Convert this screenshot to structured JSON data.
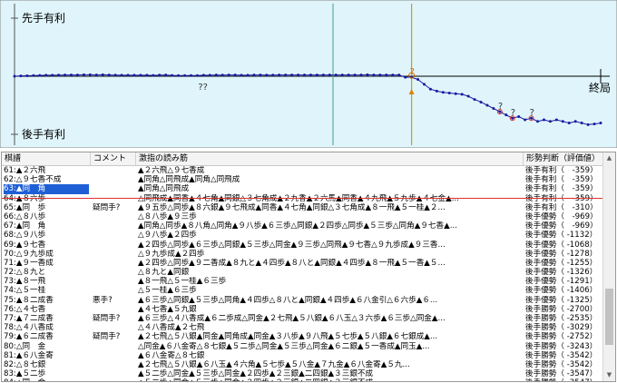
{
  "graph": {
    "label_top": "先手有利",
    "label_bottom": "後手有利",
    "label_end": "終局",
    "annotation_q": "??",
    "colors": {
      "bg": "#dff5fb",
      "line": "#1a1aa0",
      "cursor": "#d0a000",
      "vline": "#40a080"
    }
  },
  "chart_data": {
    "type": "line",
    "title": "",
    "xlabel": "",
    "ylabel": "",
    "x_range": [
      0,
      93
    ],
    "ylim": [
      -3000,
      3000
    ],
    "cursor_move": 63,
    "markers": [
      {
        "move": 30,
        "label": "??"
      },
      {
        "move": 63,
        "label": "?"
      },
      {
        "move": 77,
        "label": "?"
      },
      {
        "move": 79,
        "label": "?"
      },
      {
        "move": 82,
        "label": "?"
      }
    ],
    "series": [
      {
        "values": [
          0,
          10,
          15,
          20,
          25,
          30,
          30,
          35,
          40,
          40,
          40,
          45,
          45,
          40,
          45,
          40,
          35,
          30,
          30,
          30,
          30,
          30,
          25,
          35,
          40,
          25,
          20,
          20,
          20,
          20,
          30,
          30,
          40,
          35,
          40,
          40,
          30,
          30,
          40,
          40,
          35,
          35,
          40,
          40,
          40,
          40,
          40,
          40,
          40,
          40,
          40,
          40,
          40,
          40,
          40,
          40,
          45,
          40,
          40,
          40,
          40,
          40,
          -30,
          -30,
          -100,
          -250,
          -400,
          -460,
          -500,
          -520,
          -540,
          -560,
          -620,
          -720,
          -800,
          -900,
          -1000,
          -1100,
          -1200,
          -1300,
          -1250,
          -1350,
          -1300,
          -1400,
          -1350,
          -1400,
          -1350,
          -1400,
          -1450,
          -1400,
          -1450,
          -1500,
          -1480,
          -1450
        ]
      }
    ]
  },
  "table": {
    "headers": {
      "move": "棋譜",
      "comment": "コメント",
      "reading": "激指の読み筋",
      "eval": "形勢判断（評価値）"
    },
    "selected_index": 2,
    "rows": [
      {
        "move": "61:▲２六飛",
        "comment": "",
        "reading": "▲２六飛△９七香成",
        "eval": "後手有利（　-359）"
      },
      {
        "move": "62:△９七香不成",
        "comment": "",
        "reading": "▲同角△同飛成▲同角△同飛成",
        "eval": "後手有利（　-359）"
      },
      {
        "move": "63:▲同　角",
        "comment": "",
        "reading": "▲同角△同飛成",
        "eval": "後手有利（　-359）"
      },
      {
        "move": "64:▲８六歩",
        "comment": "",
        "reading": "△同飛成▲同香▲４七角▲同銀△３七角成▲２九香▲２六馬▲同香▲４九飛▲５九歩▲４七金▲...",
        "eval": "後手有利（　-359）"
      },
      {
        "move": "65:▲同　歩",
        "comment": "疑問手?",
        "reading": "▲９五歩△同歩▲８六銀▲９七飛成▲同香▲４七角▲同銀△３七角成▲８一飛▲５一桂▲２...",
        "eval": "後手有利（　-310）"
      },
      {
        "move": "66:△８八歩",
        "comment": "",
        "reading": "△８八歩▲９三歩",
        "eval": "後手優勢（　-969）"
      },
      {
        "move": "67:▲同　角",
        "comment": "",
        "reading": "▲同角△同歩▲８八角△同角▲９八歩▲６三歩△同銀▲２四歩△同歩▲５三歩△同角▲９七香▲...",
        "eval": "後手優勢（　-969）"
      },
      {
        "move": "68:△９八歩",
        "comment": "",
        "reading": "△９八歩▲２四歩",
        "eval": "後手優勢（ -1132）"
      },
      {
        "move": "69:▲９七香",
        "comment": "",
        "reading": "▲２四歩△同歩▲６三歩△同銀▲５三歩△同金▲９三歩△同飛▲９七香△９九歩成▲９三香...",
        "eval": "後手優勢（ -1068）"
      },
      {
        "move": "70:△９九歩成",
        "comment": "",
        "reading": "△９九歩成▲２四歩",
        "eval": "後手優勢（ -1278）"
      },
      {
        "move": "71:▲９一香成",
        "comment": "",
        "reading": "▲２四歩△同歩▲９二香成▲８九と▲４四歩▲８八と▲同銀▲４四歩▲８一飛▲５一香▲５...",
        "eval": "後手優勢（ -1255）"
      },
      {
        "move": "72:△８九と",
        "comment": "",
        "reading": "△８九と▲同銀",
        "eval": "後手優勢（ -1326）"
      },
      {
        "move": "73:▲８一飛",
        "comment": "",
        "reading": "▲８一飛△５一桂▲６三歩",
        "eval": "後手優勢（ -1291）"
      },
      {
        "move": "74:△５一桂",
        "comment": "",
        "reading": "△５一桂▲６三歩",
        "eval": "後手優勢（ -1406）"
      },
      {
        "move": "75:▲８二成香",
        "comment": "悪手?",
        "reading": "▲６三歩△同銀▲５三歩△同角▲４四歩△８八と▲同銀▲４四歩▲６八金引△６六歩▲６...",
        "eval": "後手優勢（ -1325）"
      },
      {
        "move": "76:△４七香",
        "comment": "",
        "reading": "▲４七香▲５九銀",
        "eval": "後手勝勢（ -2700）"
      },
      {
        "move": "77:▲７二成香",
        "comment": "疑問手?",
        "reading": "▲６三歩△４八香成▲６二歩成△同金▲２七飛▲５八銀▲６八玉△３六歩▲６三歩△同金▲...",
        "eval": "後手勝勢（ -2535）"
      },
      {
        "move": "78:△４八香成",
        "comment": "",
        "reading": "△４八香成▲２七飛",
        "eval": "後手勝勢（ -3029）"
      },
      {
        "move": "79:▲６二成香",
        "comment": "疑問手?",
        "reading": "▲２七飛△５八銀▲同金▲同角成▲同金▲３八歩▲９八飛▲５七歩▲５八銀▲６七銀成▲...",
        "eval": "後手勝勢（ -2752）"
      },
      {
        "move": "80:△同　金",
        "comment": "",
        "reading": "△同金▲６八金寄△８七銀▲５二歩△同金▲５三歩△同金▲６二銀▲５一香成▲同玉▲...",
        "eval": "後手勝勢（ -3243）"
      },
      {
        "move": "81:▲６八金寄",
        "comment": "",
        "reading": "▲６八金寄△８七銀",
        "eval": "後手勝勢（ -3542）"
      },
      {
        "move": "82:△８七銀",
        "comment": "",
        "reading": "▲２七飛△５八銀▲６八玉▲４六角▲５七歩▲５八金▲７九金▲６八金寄▲５九...",
        "eval": "後手勝勢（ -3542）"
      },
      {
        "move": "83:▲５二歩",
        "comment": "",
        "reading": "▲５二歩△同金▲５三歩△同金▲２四歩▲２三銀▲二四銀▲３三銀不成",
        "eval": "後手勝勢（ -3547）"
      },
      {
        "move": "84:△同　金",
        "comment": "",
        "reading": "▲５二歩△同金▲５三歩△同金▲２四歩▲２三銀▲二四銀▲３三銀不成",
        "eval": "後手勝勢（ -3547）"
      }
    ]
  }
}
